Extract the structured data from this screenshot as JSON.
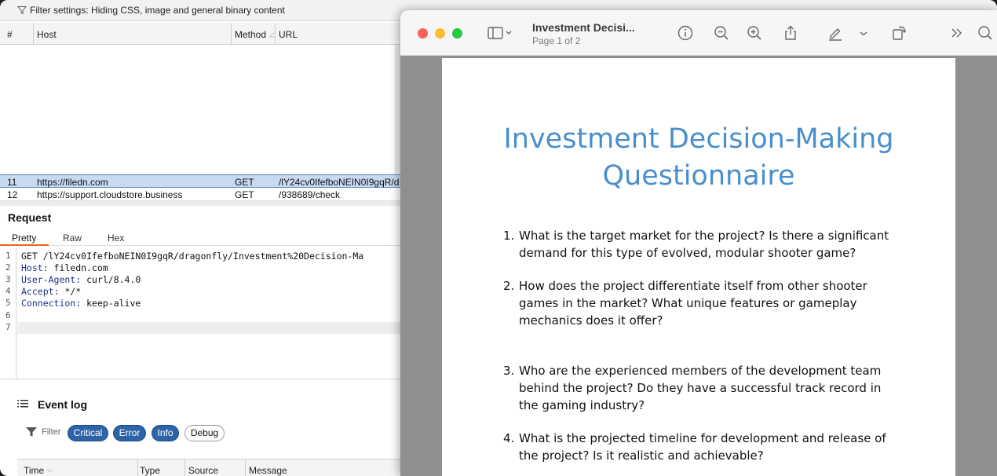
{
  "burp": {
    "filter_text": "Filter settings: Hiding CSS, image and general binary content",
    "columns": {
      "num": "#",
      "host": "Host",
      "method": "Method",
      "url": "URL"
    },
    "rows": [
      {
        "num": "11",
        "host": "https://filedn.com",
        "method": "GET",
        "url": "/lY24cv0IfefboNEIN0I9gqR/d"
      },
      {
        "num": "12",
        "host": "https://support.cloudstore.business",
        "method": "GET",
        "url": "/938689/check"
      }
    ],
    "request": {
      "title": "Request",
      "tabs": [
        "Pretty",
        "Raw",
        "Hex"
      ],
      "lines": [
        {
          "n": "1",
          "key": "",
          "text": "GET /lY24cv0IfefboNEIN0I9gqR/dragonfly/Investment%20Decision-Ma"
        },
        {
          "n": "2",
          "key": "Host:",
          "text": " filedn.com"
        },
        {
          "n": "3",
          "key": "User-Agent:",
          "text": " curl/8.4.0"
        },
        {
          "n": "4",
          "key": "Accept:",
          "text": " */*"
        },
        {
          "n": "5",
          "key": "Connection:",
          "text": " keep-alive"
        },
        {
          "n": "6",
          "key": "",
          "text": ""
        },
        {
          "n": "7",
          "key": "",
          "text": ""
        }
      ]
    },
    "event_log": {
      "title": "Event log",
      "filter_label": "Filter",
      "pills": [
        "Critical",
        "Error",
        "Info",
        "Debug"
      ],
      "columns": {
        "time": "Time",
        "type": "Type",
        "source": "Source",
        "message": "Message"
      }
    }
  },
  "preview": {
    "title": "Investment Decisi...",
    "subtitle": "Page 1 of 2",
    "document": {
      "heading_line1": "Investment Decision-Making",
      "heading_line2": "Questionnaire",
      "questions": [
        {
          "num": "1.",
          "lines": [
            "What is the target market for the project? Is there a significant",
            "demand for this type of evolved, modular shooter game?"
          ]
        },
        {
          "num": "2.",
          "lines": [
            "How does the project differentiate itself from other shooter",
            "games in the market? What unique features or gameplay",
            "mechanics does it offer?"
          ]
        },
        {
          "num": "3.",
          "lines": [
            "Who are the experienced members of the development team",
            "behind the project? Do they have a successful track record in",
            "the gaming industry?"
          ]
        },
        {
          "num": "4.",
          "lines": [
            "What is the projected timeline for development and release of",
            "the project? Is it realistic and achievable?"
          ]
        }
      ]
    }
  },
  "colors": {
    "heading_blue": "#4a8fcd",
    "selected_row": "#c8daf2",
    "pill_active": "#2d64a8",
    "tab_accent": "#e8661a",
    "traffic_red": "#fe5f57",
    "traffic_yellow": "#febc2e",
    "traffic_green": "#28c840"
  }
}
